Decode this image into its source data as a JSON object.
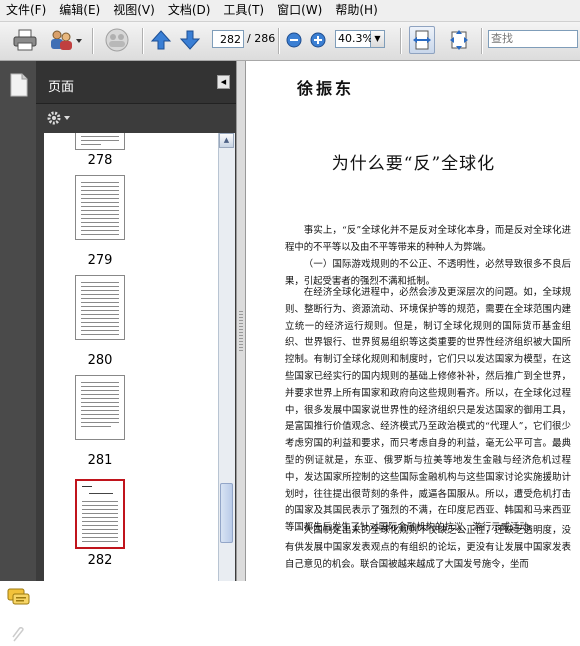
{
  "menu": [
    "文件(F)",
    "编辑(E)",
    "视图(V)",
    "文档(D)",
    "工具(T)",
    "窗口(W)",
    "帮助(H)"
  ],
  "toolbar": {
    "page_current": "282",
    "page_total": "/ 286",
    "zoom": "40.3%",
    "search_placeholder": "查找"
  },
  "panel": {
    "title": "页面",
    "thumbnails": [
      {
        "label": "278"
      },
      {
        "label": "279"
      },
      {
        "label": "280"
      },
      {
        "label": "281"
      },
      {
        "label": "282",
        "selected": true
      }
    ]
  },
  "document": {
    "author": "徐振东",
    "title": "为什么要“反”全球化",
    "paragraphs": [
      "事实上，“反”全球化并不是反对全球化本身，而是反对全球化进程中的不平等以及由不平等带来的种种人为弊端。",
      "（一）国际游戏规则的不公正、不透明性，必然导致很多不良后果，引起受害者的强烈不满和抵制。",
      "在经济全球化进程中，必然会涉及更深层次的问题。如，全球规则、整断行为、资源流动、环境保护等的规范，需要在全球范围内建立统一的经济运行规则。但是，制订全球化规则的国际货币基金组织、世界银行、世界贸易组织等这类重要的世界性经济组织被大国所控制。有制订全球化规则和制度时，它们只以发达国家为模型，在这些国家已经实行的国内规则的基础上修修补补，然后推广到全世界，并要求世界上所有国家和政府向这些规则看齐。所以，在全球化过程中，很多发展中国家说世界性的经济组织只是发达国家的御用工具，是富国推行价值观念、经济模式乃至政治模式的“代理人”，它们很少考虑穷国的利益和要求，而只考虑自身的利益，毫无公平可言。最典型的例证就是，东亚、俄罗斯与拉美等地发生金融与经济危机过程中，发达国家所控制的这些国际金融机构与这些国家讨论实施援助计划时，往往提出很苛刻的条件，威逼各国服从。所以，遭受危机打击的国家及其国民表示了强烈的不满，在印度尼西亚、韩国和马来西亚等国都先后发生了针对国际金融机构的抗议、游行示威活动。",
      "大国制定出来的全球化规则不仅缺乏公正性，还缺乏透明度，没有供发展中国家发表观点的有组织的论坛，更没有让发展中国家发表自己意见的机会。联合国被越来越成了大国发号施令，坐而"
    ]
  },
  "icons": {
    "nav_pages": "pages-icon",
    "nav_comments": "comments-icon",
    "nav_attach": "attachment-icon"
  }
}
